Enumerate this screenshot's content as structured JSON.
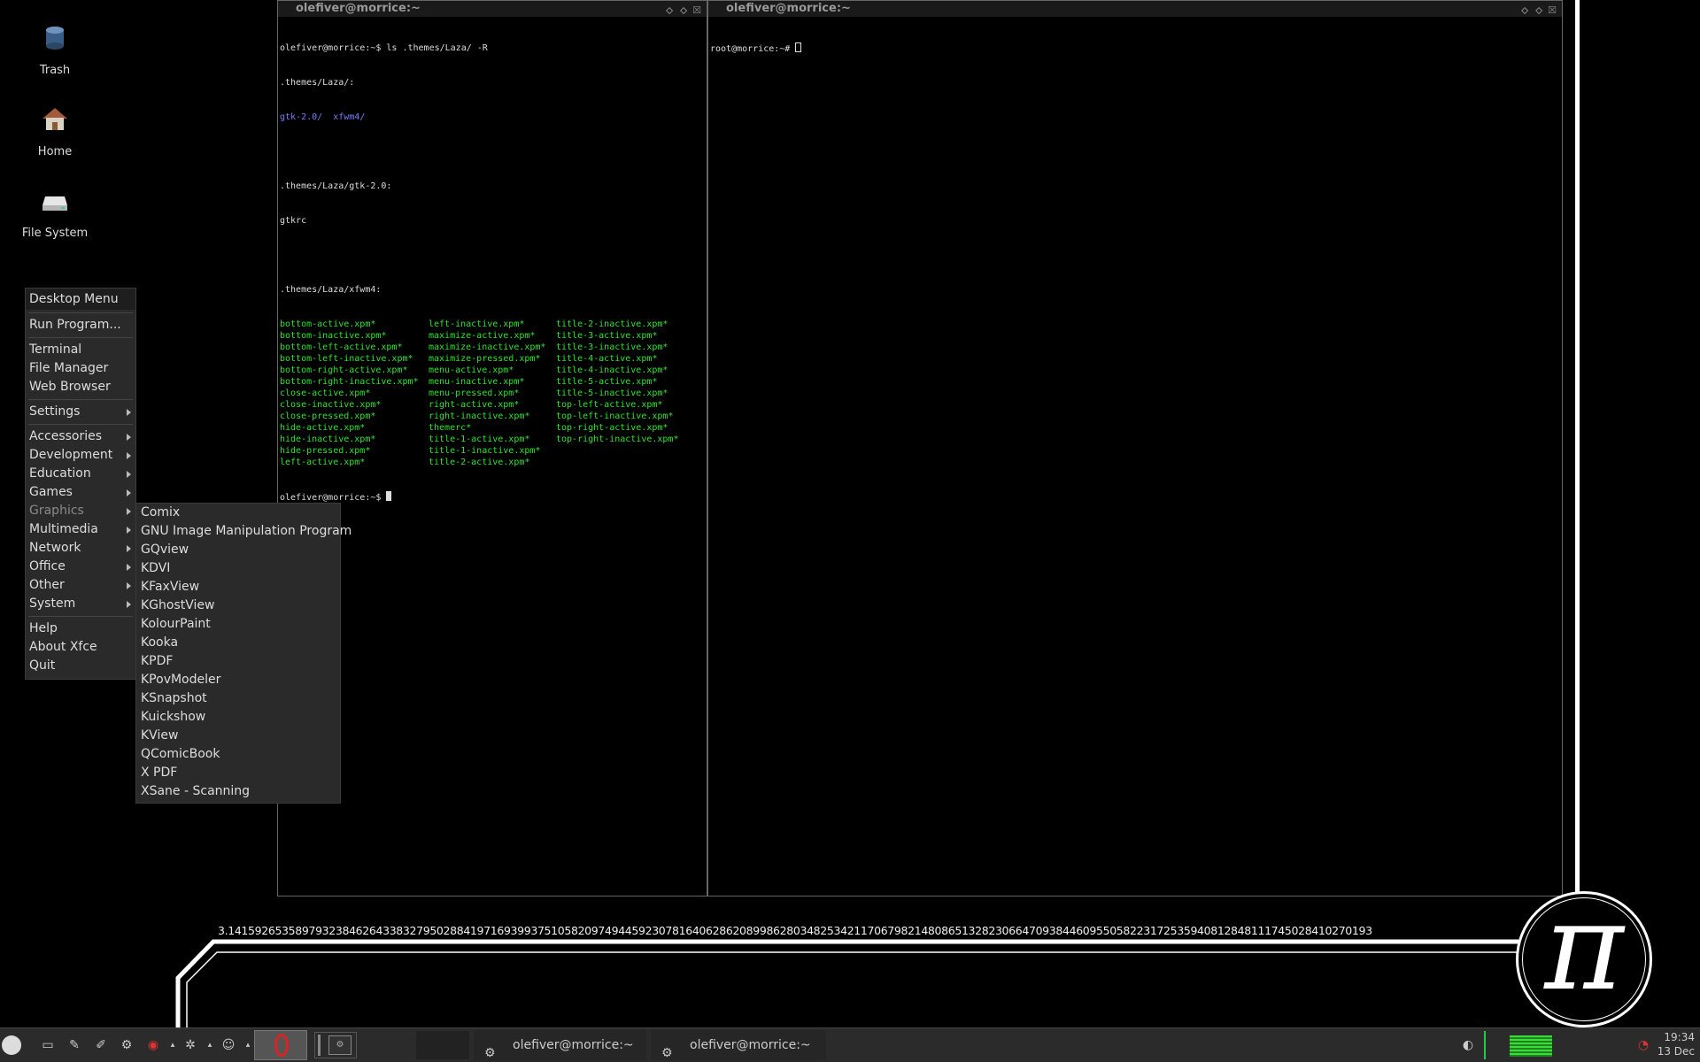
{
  "desktop_icons": [
    {
      "label": "Trash",
      "icon": "trash-icon"
    },
    {
      "label": "Home",
      "icon": "home-icon"
    },
    {
      "label": "File System",
      "icon": "drive-icon"
    }
  ],
  "terminal_left": {
    "title": "olefiver@morrice:~",
    "lines": [
      "olefiver@morrice:~$ ls .themes/Laza/ -R",
      ".themes/Laza/:",
      "",
      "",
      ".themes/Laza/gtk-2.0:",
      "gtkrc",
      "",
      ".themes/Laza/xfwm4:"
    ],
    "dirs": [
      "gtk-2.0/",
      "xfwm4/"
    ],
    "col1": [
      "bottom-active.xpm*",
      "bottom-inactive.xpm*",
      "bottom-left-active.xpm*",
      "bottom-left-inactive.xpm*",
      "bottom-right-active.xpm*",
      "bottom-right-inactive.xpm*",
      "close-active.xpm*",
      "close-inactive.xpm*",
      "close-pressed.xpm*",
      "hide-active.xpm*",
      "hide-inactive.xpm*",
      "hide-pressed.xpm*",
      "left-active.xpm*"
    ],
    "col2": [
      "left-inactive.xpm*",
      "maximize-active.xpm*",
      "maximize-inactive.xpm*",
      "maximize-pressed.xpm*",
      "menu-active.xpm*",
      "menu-inactive.xpm*",
      "menu-pressed.xpm*",
      "right-active.xpm*",
      "right-inactive.xpm*",
      "themerc*",
      "title-1-active.xpm*",
      "title-1-inactive.xpm*",
      "title-2-active.xpm*"
    ],
    "col3": [
      "title-2-inactive.xpm*",
      "title-3-active.xpm*",
      "title-3-inactive.xpm*",
      "title-4-active.xpm*",
      "title-4-inactive.xpm*",
      "title-5-active.xpm*",
      "title-5-inactive.xpm*",
      "top-left-active.xpm*",
      "top-left-inactive.xpm*",
      "top-right-active.xpm*",
      "top-right-inactive.xpm*"
    ],
    "prompt": "olefiver@morrice:~$ "
  },
  "terminal_right": {
    "title": "olefiver@morrice:~",
    "prompt": "root@morrice:~# "
  },
  "desktop_menu": {
    "header": "Desktop Menu",
    "groups": [
      [
        {
          "label": "Run Program...",
          "sub": false
        }
      ],
      [
        {
          "label": "Terminal",
          "sub": false
        },
        {
          "label": "File Manager",
          "sub": false
        },
        {
          "label": "Web Browser",
          "sub": false
        }
      ],
      [
        {
          "label": "Settings",
          "sub": true
        }
      ],
      [
        {
          "label": "Accessories",
          "sub": true
        },
        {
          "label": "Development",
          "sub": true
        },
        {
          "label": "Education",
          "sub": true
        },
        {
          "label": "Games",
          "sub": true
        },
        {
          "label": "Graphics",
          "sub": true,
          "selected": true
        },
        {
          "label": "Multimedia",
          "sub": true
        },
        {
          "label": "Network",
          "sub": true
        },
        {
          "label": "Office",
          "sub": true
        },
        {
          "label": "Other",
          "sub": true
        },
        {
          "label": "System",
          "sub": true
        }
      ],
      [
        {
          "label": "Help",
          "sub": false
        },
        {
          "label": "About Xfce",
          "sub": false
        },
        {
          "label": "Quit",
          "sub": false
        }
      ]
    ]
  },
  "graphics_submenu": [
    "Comix",
    "GNU Image Manipulation Program",
    "GQview",
    "KDVI",
    "KFaxView",
    "KGhostView",
    "KolourPaint",
    "Kooka",
    "KPDF",
    "KPovModeler",
    "KSnapshot",
    "Kuickshow",
    "KView",
    "QComicBook",
    "X PDF",
    "XSane - Scanning"
  ],
  "pi_digits": "3.14159265358979323846264338327950288419716939937510582097494459230781640628620899862803482534211706798214808651328230664709384460955058223172535940812848111745028410270193",
  "pi_symbol": "π",
  "taskbar": {
    "tasks": [
      {
        "label": "olefiver@morrice:~"
      },
      {
        "label": "olefiver@morrice:~"
      }
    ],
    "clock_time": "19:34",
    "clock_date": "13 Dec"
  }
}
